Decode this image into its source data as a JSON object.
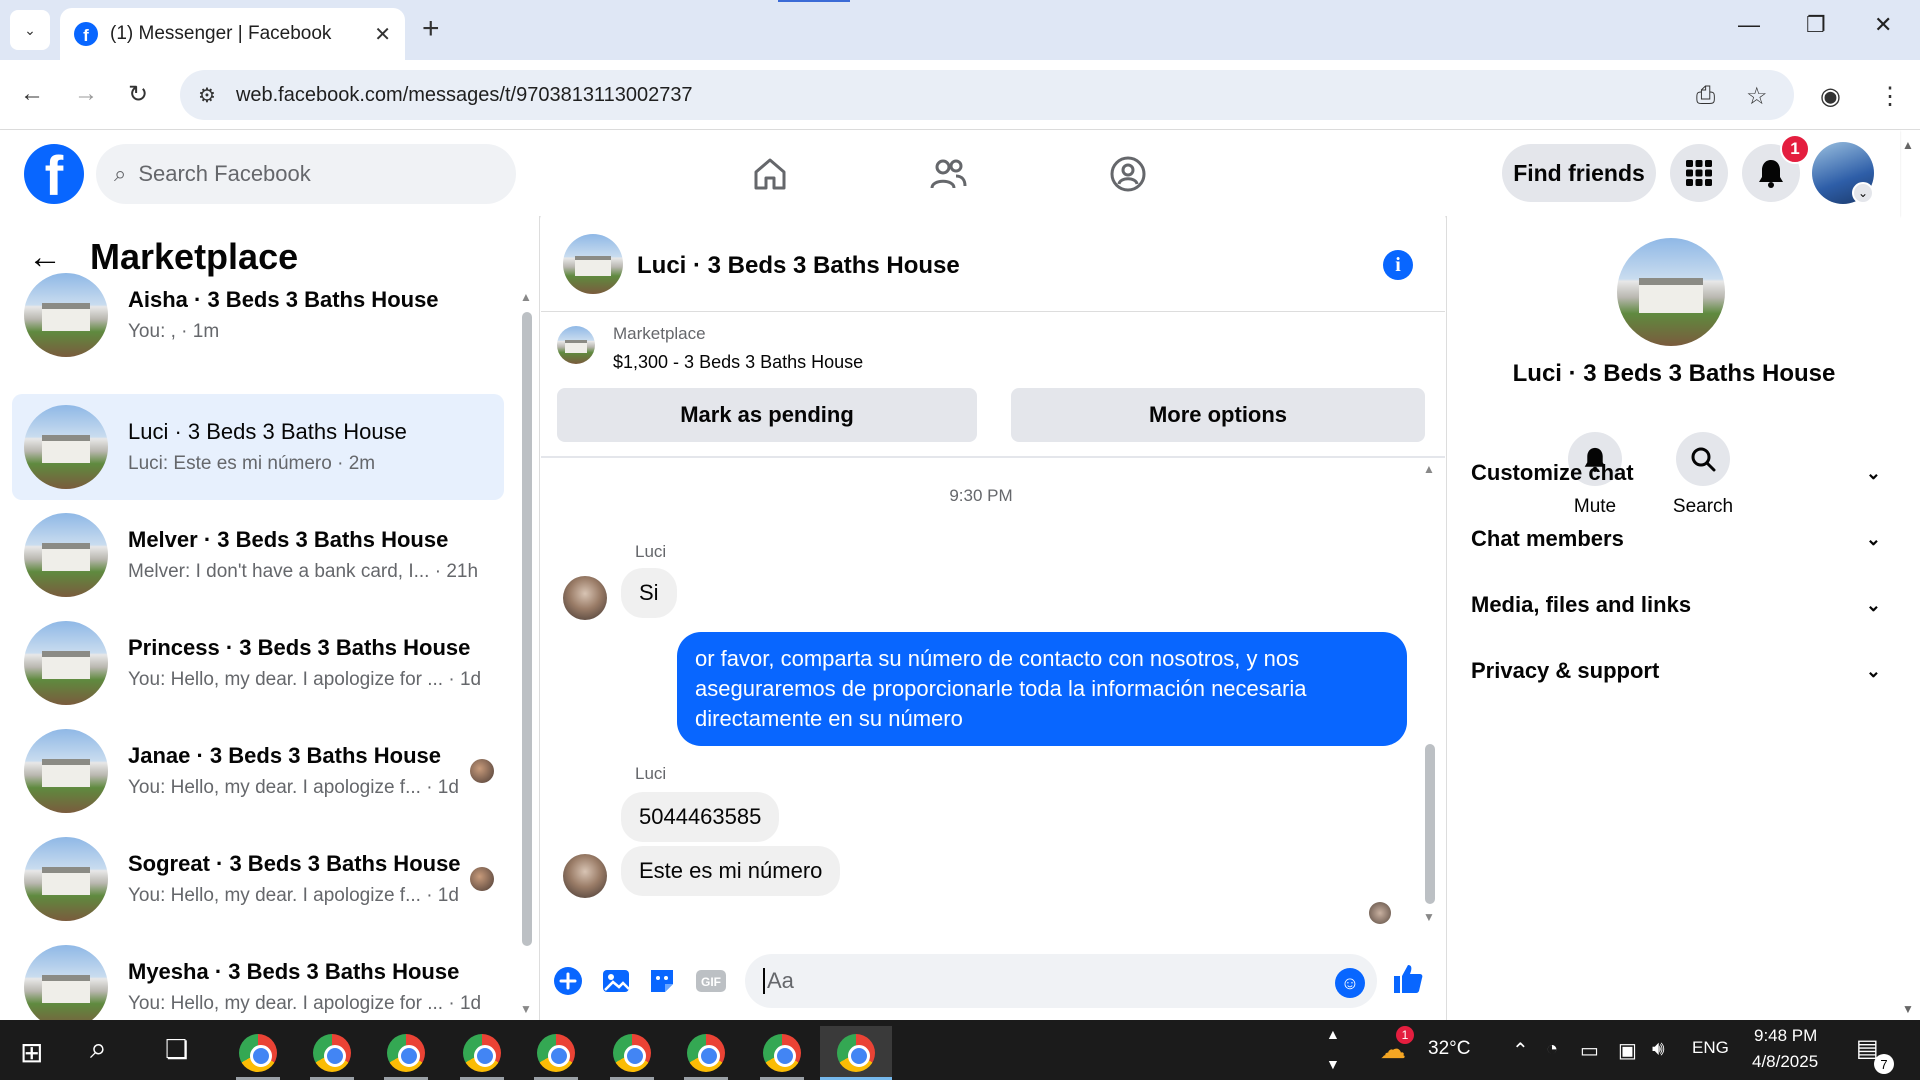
{
  "browser": {
    "tab_title": "(1) Messenger | Facebook",
    "tab_close": "✕",
    "new_tab": "+",
    "url": "web.facebook.com/messages/t/9703813113002737"
  },
  "fb_header": {
    "logo_letter": "f",
    "search_placeholder": "Search Facebook",
    "find_friends": "Find friends",
    "notification_count": "1"
  },
  "sidebar": {
    "title": "Marketplace",
    "conversations": [
      {
        "name": "Aisha · 3 Beds 3 Baths House",
        "snippet": "You: , · 1m",
        "active": false,
        "unread": true
      },
      {
        "name": "Luci · 3 Beds 3 Baths House",
        "snippet": "Luci: Este es mi número · 2m",
        "active": true,
        "unread": false
      },
      {
        "name": "Melver · 3 Beds 3 Baths House",
        "snippet": "Melver: I don't have a bank card, I... · 21h",
        "active": false,
        "unread": true
      },
      {
        "name": "Princess · 3 Beds 3 Baths House",
        "snippet": "You: Hello, my dear. I apologize for ... · 1d",
        "active": false,
        "unread": true
      },
      {
        "name": "Janae · 3 Beds 3 Baths House",
        "snippet": "You: Hello, my dear. I apologize f... · 1d",
        "active": false,
        "unread": true
      },
      {
        "name": "Sogreat · 3 Beds 3 Baths House",
        "snippet": "You: Hello, my dear. I apologize f... · 1d",
        "active": false,
        "unread": true
      },
      {
        "name": "Myesha · 3 Beds 3 Baths House",
        "snippet": "You: Hello, my dear. I apologize for ... · 1d",
        "active": false,
        "unread": true
      }
    ]
  },
  "chat": {
    "title": "Luci · 3 Beds 3 Baths House",
    "listing_label": "Marketplace",
    "listing_price": "$1,300 - 3 Beds 3 Baths House",
    "mark_pending": "Mark as pending",
    "more_options": "More options",
    "timestamp": "9:30 PM",
    "sender_name": "Luci",
    "msg_in_1": "Si",
    "msg_out_1": "or favor, comparta su número de contacto con nosotros, y nos aseguraremos de proporcionarle toda la información necesaria directamente en su número",
    "msg_in_2": "5044463585",
    "msg_in_3": "Este es mi número",
    "composer_placeholder": "Aa"
  },
  "right_panel": {
    "title": "Luci · 3 Beds 3 Baths House",
    "mute_label": "Mute",
    "search_label": "Search",
    "sections": [
      "Customize chat",
      "Chat members",
      "Media, files and links",
      "Privacy & support"
    ]
  },
  "taskbar": {
    "temperature": "32°C",
    "language": "ENG",
    "time": "9:48 PM",
    "date": "4/8/2025",
    "notification_count": "7",
    "weather_badge": "1"
  },
  "colors": {
    "brand_blue": "#0866ff",
    "active_conv_bg": "#e7f0fd",
    "bubble_in": "#f0f0f0",
    "badge_red": "#e41e3f"
  }
}
